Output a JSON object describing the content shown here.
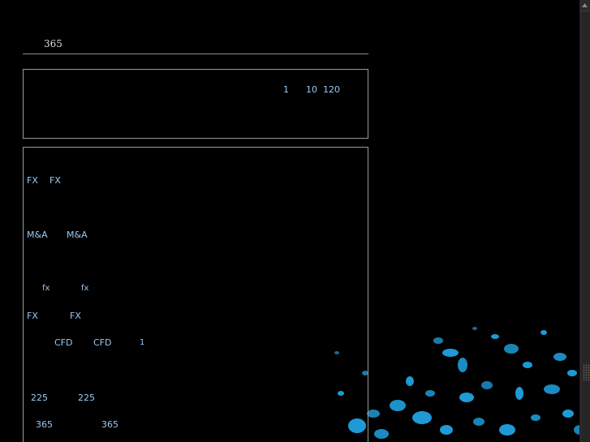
{
  "header": {
    "title": "365"
  },
  "top_panel": {
    "items": [
      "1",
      "10",
      "120"
    ]
  },
  "main_panel": {
    "rows": [
      [
        "FX",
        "FX"
      ],
      [
        "M&A",
        "M&A"
      ],
      [
        "fx",
        "fx"
      ],
      [
        "FX",
        "FX"
      ],
      [
        "CFD",
        "CFD",
        "1"
      ],
      [
        "225",
        "225"
      ],
      [
        "365",
        "365"
      ]
    ]
  },
  "colors": {
    "background": "#000000",
    "text_accent": "#9cc8f0",
    "border": "#9a9a9a",
    "splatter": "#1e9ad6"
  },
  "icons": {
    "scroll_up": "triangle-up-icon"
  }
}
